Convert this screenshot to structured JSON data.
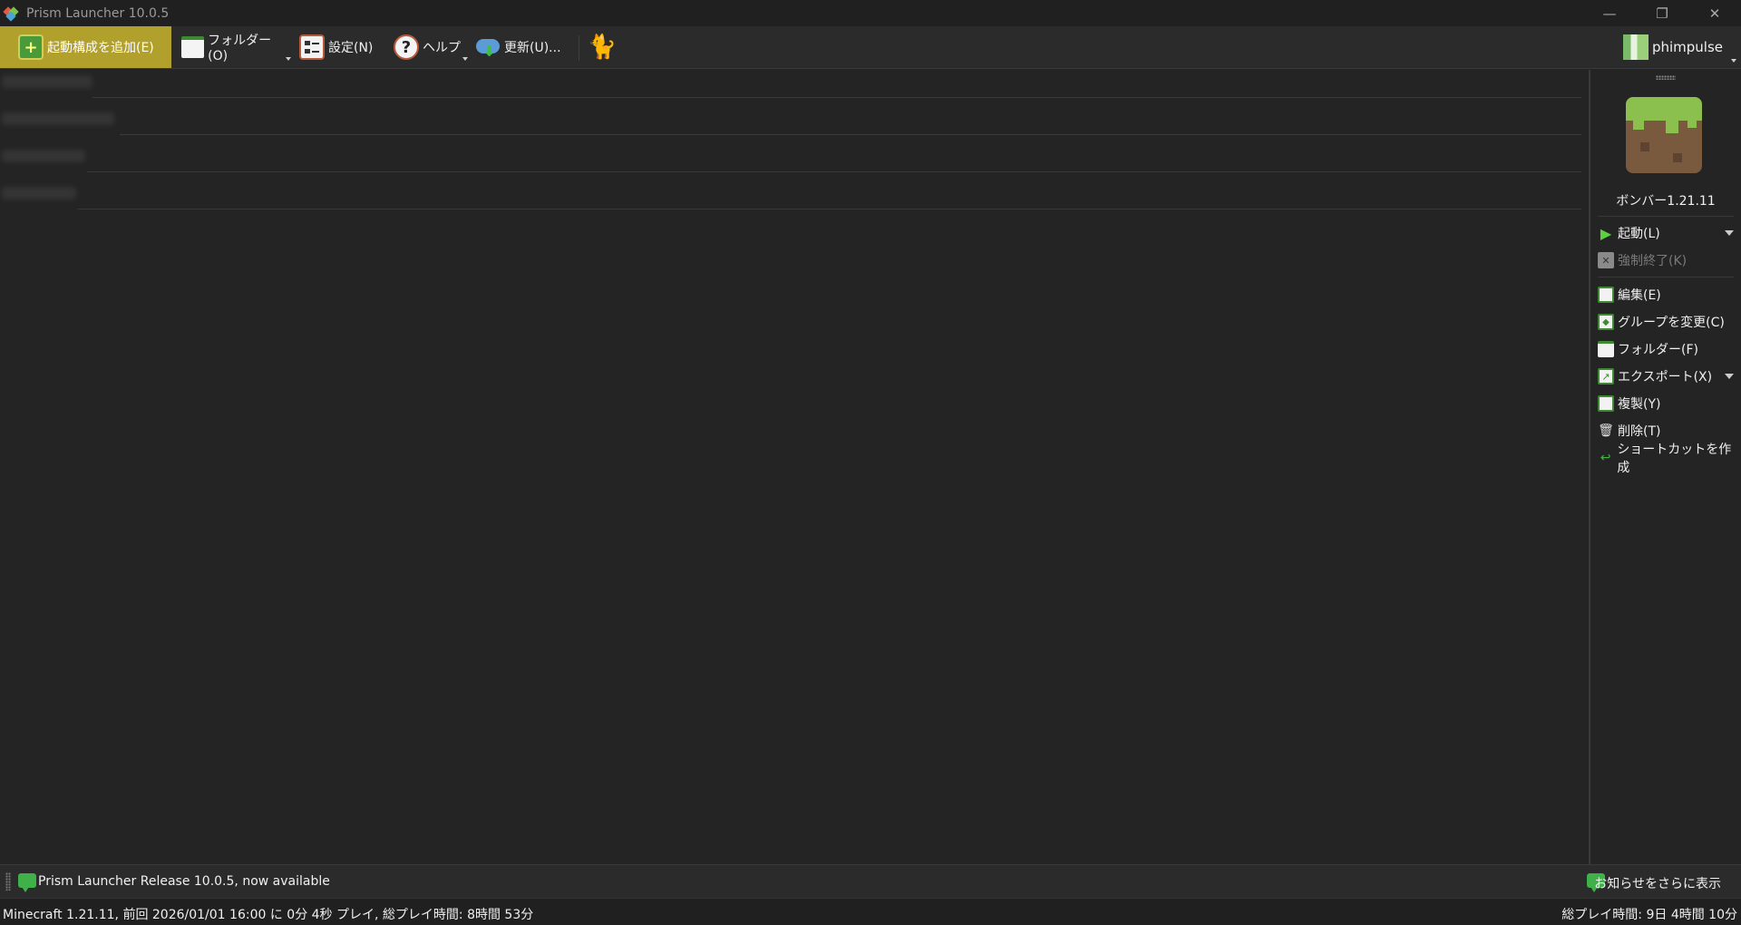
{
  "window": {
    "title": "Prism Launcher 10.0.5",
    "minimize_glyph": "—",
    "restore_glyph": "❐",
    "close_glyph": "✕"
  },
  "toolbar": {
    "add_instance": "起動構成を追加(E)",
    "folders": "フォルダー(O)",
    "settings": "設定(N)",
    "help": "ヘルプ",
    "update": "更新(U)...",
    "account_name": "phimpulse",
    "add_icon_glyph": "+",
    "help_icon_glyph": "?",
    "update_arrow_glyph": "⬇",
    "cat_glyph": "🐈"
  },
  "instance_groups": [
    {
      "label": "",
      "state": "blurred"
    },
    {
      "label": "",
      "state": "blurred"
    },
    {
      "label": "",
      "state": "blurred"
    },
    {
      "label": "",
      "state": "blurred"
    }
  ],
  "side_panel": {
    "instance_name": "ボンバー1.21.11",
    "actions": [
      {
        "label": "起動(L)",
        "icon": "play-icon",
        "glyph": "▶",
        "enabled": true,
        "dropdown": true
      },
      {
        "label": "強制終了(K)",
        "icon": "kill-icon",
        "glyph": "✕",
        "enabled": false,
        "dropdown": false
      },
      {
        "label": "編集(E)",
        "icon": "edit-icon",
        "glyph": "",
        "enabled": true,
        "dropdown": false
      },
      {
        "label": "グループを変更(C)",
        "icon": "tag-icon",
        "glyph": "◆",
        "enabled": true,
        "dropdown": false
      },
      {
        "label": "フォルダー(F)",
        "icon": "folder-icon",
        "glyph": "",
        "enabled": true,
        "dropdown": false
      },
      {
        "label": "エクスポート(X)",
        "icon": "export-icon",
        "glyph": "↗",
        "enabled": true,
        "dropdown": true
      },
      {
        "label": "複製(Y)",
        "icon": "copy-icon",
        "glyph": "",
        "enabled": true,
        "dropdown": false
      },
      {
        "label": "削除(T)",
        "icon": "trash-icon",
        "glyph": "🗑",
        "enabled": true,
        "dropdown": false
      },
      {
        "label": "ショートカットを作成",
        "icon": "shortcut-icon",
        "glyph": "↩",
        "enabled": true,
        "dropdown": false
      }
    ]
  },
  "news": {
    "headline": "Prism Launcher Release 10.0.5, now available",
    "more": "お知らせをさらに表示"
  },
  "status": {
    "left": "Minecraft 1.21.11, 前回 2026/01/01 16:00 に 0分 4秒 プレイ, 総プレイ時間: 8時間 53分",
    "right": "総プレイ時間: 9日 4時間 10分"
  },
  "colors": {
    "active_button": "#b2a02c",
    "background": "#242424",
    "accent_green": "#3fb04a"
  }
}
